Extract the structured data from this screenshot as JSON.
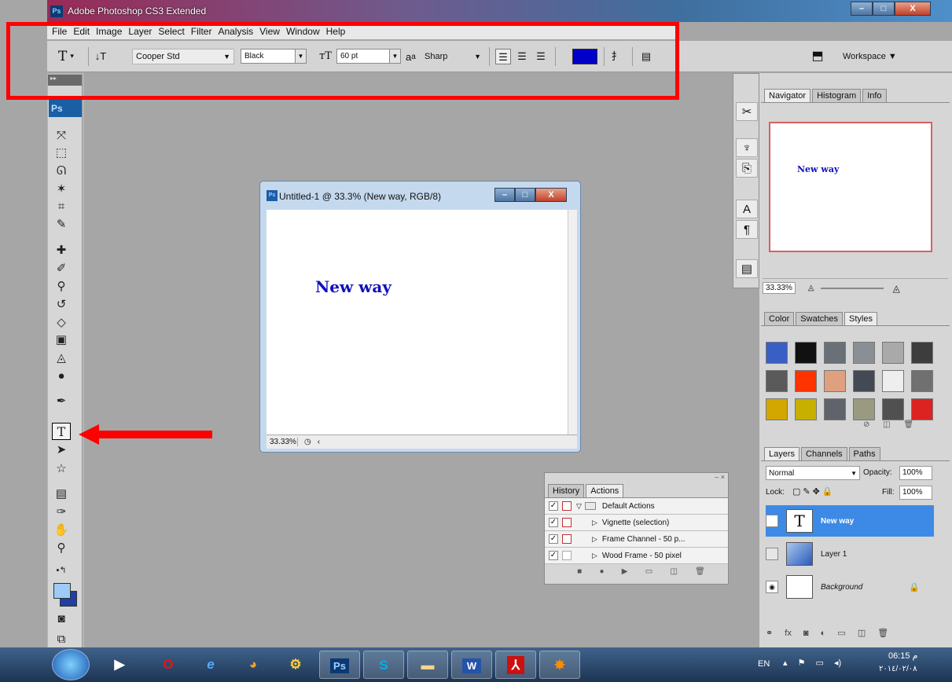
{
  "window": {
    "app_title": "Adobe Photoshop CS3 Extended",
    "ps_badge": "Ps",
    "min": "–",
    "max": "□",
    "close": "X"
  },
  "menu": [
    "File",
    "Edit",
    "Image",
    "Layer",
    "Select",
    "Filter",
    "Analysis",
    "View",
    "Window",
    "Help"
  ],
  "options": {
    "tool_glyph": "T",
    "font_family": "Cooper Std",
    "font_style": "Black",
    "font_size": "60 pt",
    "antialias_prefix": "a",
    "antialias_sub": "a",
    "antialias": "Sharp",
    "text_color": "#0000c8",
    "workspace": "Workspace ▼"
  },
  "document": {
    "title": "Untitled-1 @ 33.3% (New way, RGB/8)",
    "canvas_text": "New way",
    "canvas_text_color": "#1111bb",
    "zoom": "33.33%"
  },
  "actions_panel": {
    "tabs": [
      "History",
      "Actions"
    ],
    "rows": [
      {
        "label": "Default Actions",
        "type": "folder"
      },
      {
        "label": "Vignette (selection)",
        "type": "action"
      },
      {
        "label": "Frame Channel - 50 p...",
        "type": "action"
      },
      {
        "label": "Wood Frame - 50 pixel",
        "type": "action"
      }
    ]
  },
  "navigator": {
    "tabs": [
      "Navigator",
      "Histogram",
      "Info"
    ],
    "thumb_text": "New way",
    "zoom": "33.33%"
  },
  "styles_panel": {
    "tabs": [
      "Color",
      "Swatches",
      "Styles"
    ],
    "swatches": [
      "#3a5fc4",
      "#111111",
      "#6a7078",
      "#8a8f96",
      "#a9a9a9",
      "#3d3d3d",
      "#5a5a5a",
      "#ff3300",
      "#e0a080",
      "#444a55",
      "#eeeeee",
      "#707070",
      "#d4a600",
      "#c8b000",
      "#60646a",
      "#9a9a80",
      "#505050",
      "#dd2222"
    ]
  },
  "layers_panel": {
    "tabs": [
      "Layers",
      "Channels",
      "Paths"
    ],
    "blend_mode": "Normal",
    "opacity_label": "Opacity:",
    "opacity": "100%",
    "lock_label": "Lock:",
    "fill_label": "Fill:",
    "fill": "100%",
    "layers": [
      {
        "name": "New way",
        "selected": true,
        "visible": true,
        "kind": "text"
      },
      {
        "name": "Layer 1",
        "selected": false,
        "visible": false,
        "kind": "image"
      },
      {
        "name": "Background",
        "selected": false,
        "visible": true,
        "kind": "background"
      }
    ]
  },
  "taskbar": {
    "language": "EN",
    "time": "06:15 م",
    "date": "٢٠١٤/٠٢/٠٨",
    "ps_label": "Ps",
    "word_label": "W"
  }
}
